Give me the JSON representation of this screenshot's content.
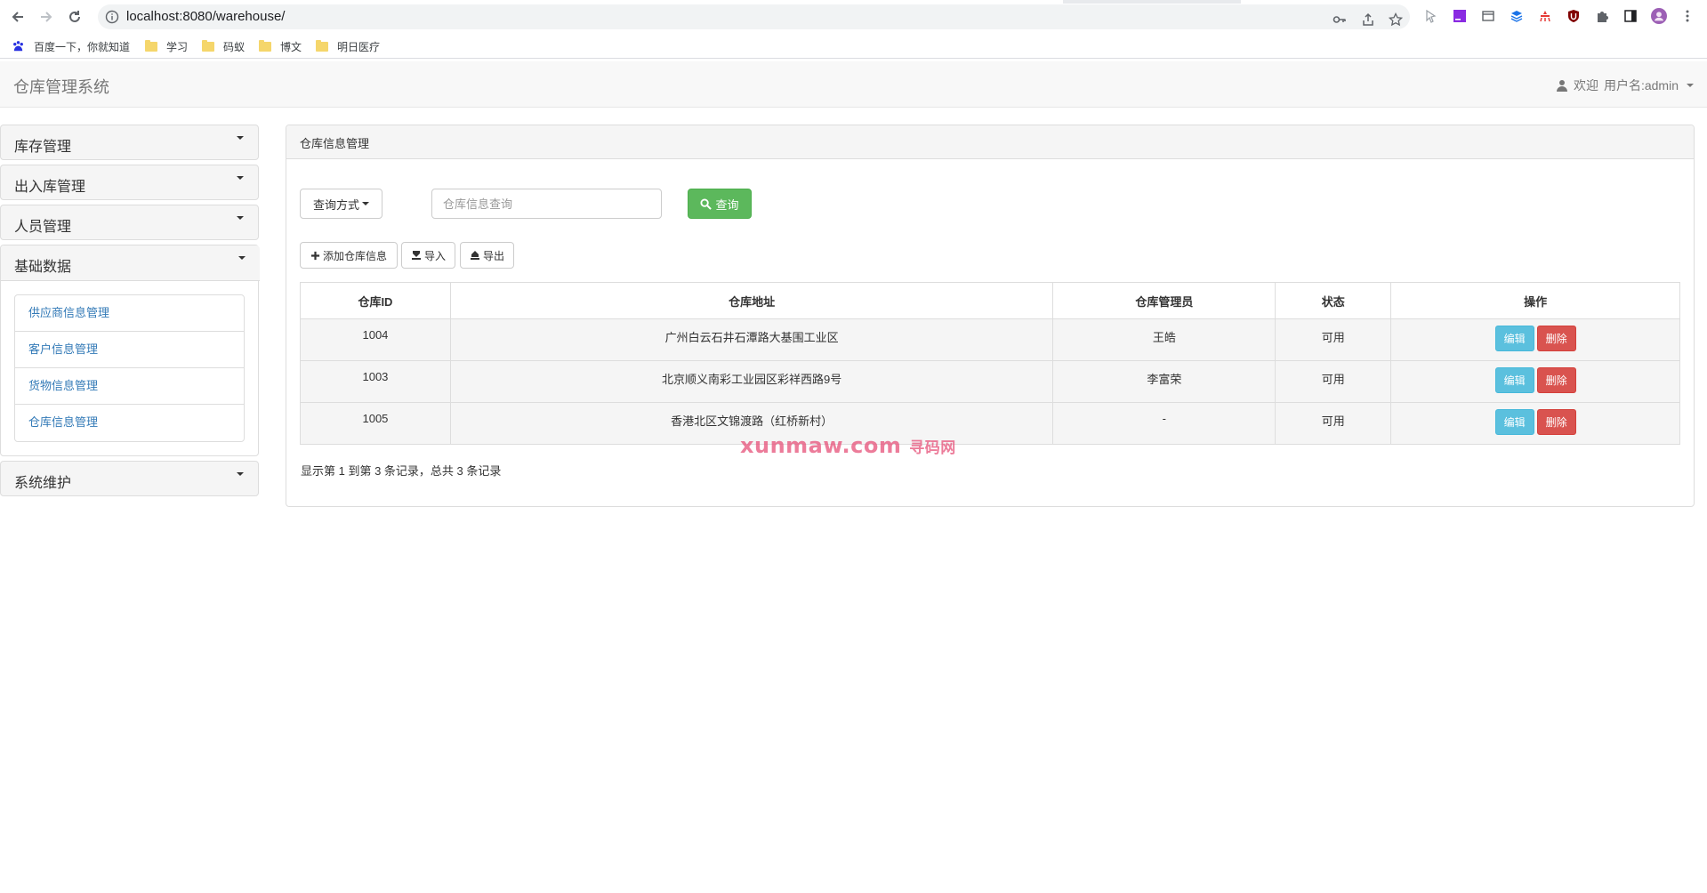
{
  "browser": {
    "url": "localhost:8080/warehouse/",
    "bookmarks": [
      {
        "label": "百度一下，你就知道",
        "icon": "baidu-paw-icon"
      },
      {
        "label": "学习",
        "icon": "folder-icon"
      },
      {
        "label": "码蚁",
        "icon": "folder-icon"
      },
      {
        "label": "博文",
        "icon": "folder-icon"
      },
      {
        "label": "明日医疗",
        "icon": "folder-icon"
      }
    ]
  },
  "navbar": {
    "brand": "仓库管理系统",
    "welcome": "欢迎",
    "username": "用户名:admin"
  },
  "sidebar": {
    "groups": [
      {
        "title": "库存管理"
      },
      {
        "title": "出入库管理"
      },
      {
        "title": "人员管理"
      },
      {
        "title": "基础数据",
        "items": [
          "供应商信息管理",
          "客户信息管理",
          "货物信息管理",
          "仓库信息管理"
        ]
      },
      {
        "title": "系统维护"
      }
    ]
  },
  "main": {
    "title": "仓库信息管理",
    "query_mode": "查询方式",
    "search_placeholder": "仓库信息查询",
    "search_button": "查询",
    "add_button": "添加仓库信息",
    "import_button": "导入",
    "export_button": "导出",
    "table": {
      "headers": [
        "仓库ID",
        "仓库地址",
        "仓库管理员",
        "状态",
        "操作"
      ],
      "rows": [
        {
          "id": "1004",
          "address": "广州白云石井石潭路大基围工业区",
          "manager": "王皓",
          "status": "可用"
        },
        {
          "id": "1003",
          "address": "北京顺义南彩工业园区彩祥西路9号",
          "manager": "李富荣",
          "status": "可用"
        },
        {
          "id": "1005",
          "address": "香港北区文锦渡路（红桥新村）",
          "manager": "-",
          "status": "可用"
        }
      ],
      "edit_label": "编辑",
      "delete_label": "删除"
    },
    "pagination_info": "显示第 1 到第 3 条记录，总共 3 条记录"
  },
  "watermark": {
    "latin": "xunmaw.com",
    "cn": "寻码网"
  },
  "colors": {
    "success": "#5cb85c",
    "info": "#5bc0de",
    "danger": "#d9534f",
    "link": "#337ab7"
  }
}
